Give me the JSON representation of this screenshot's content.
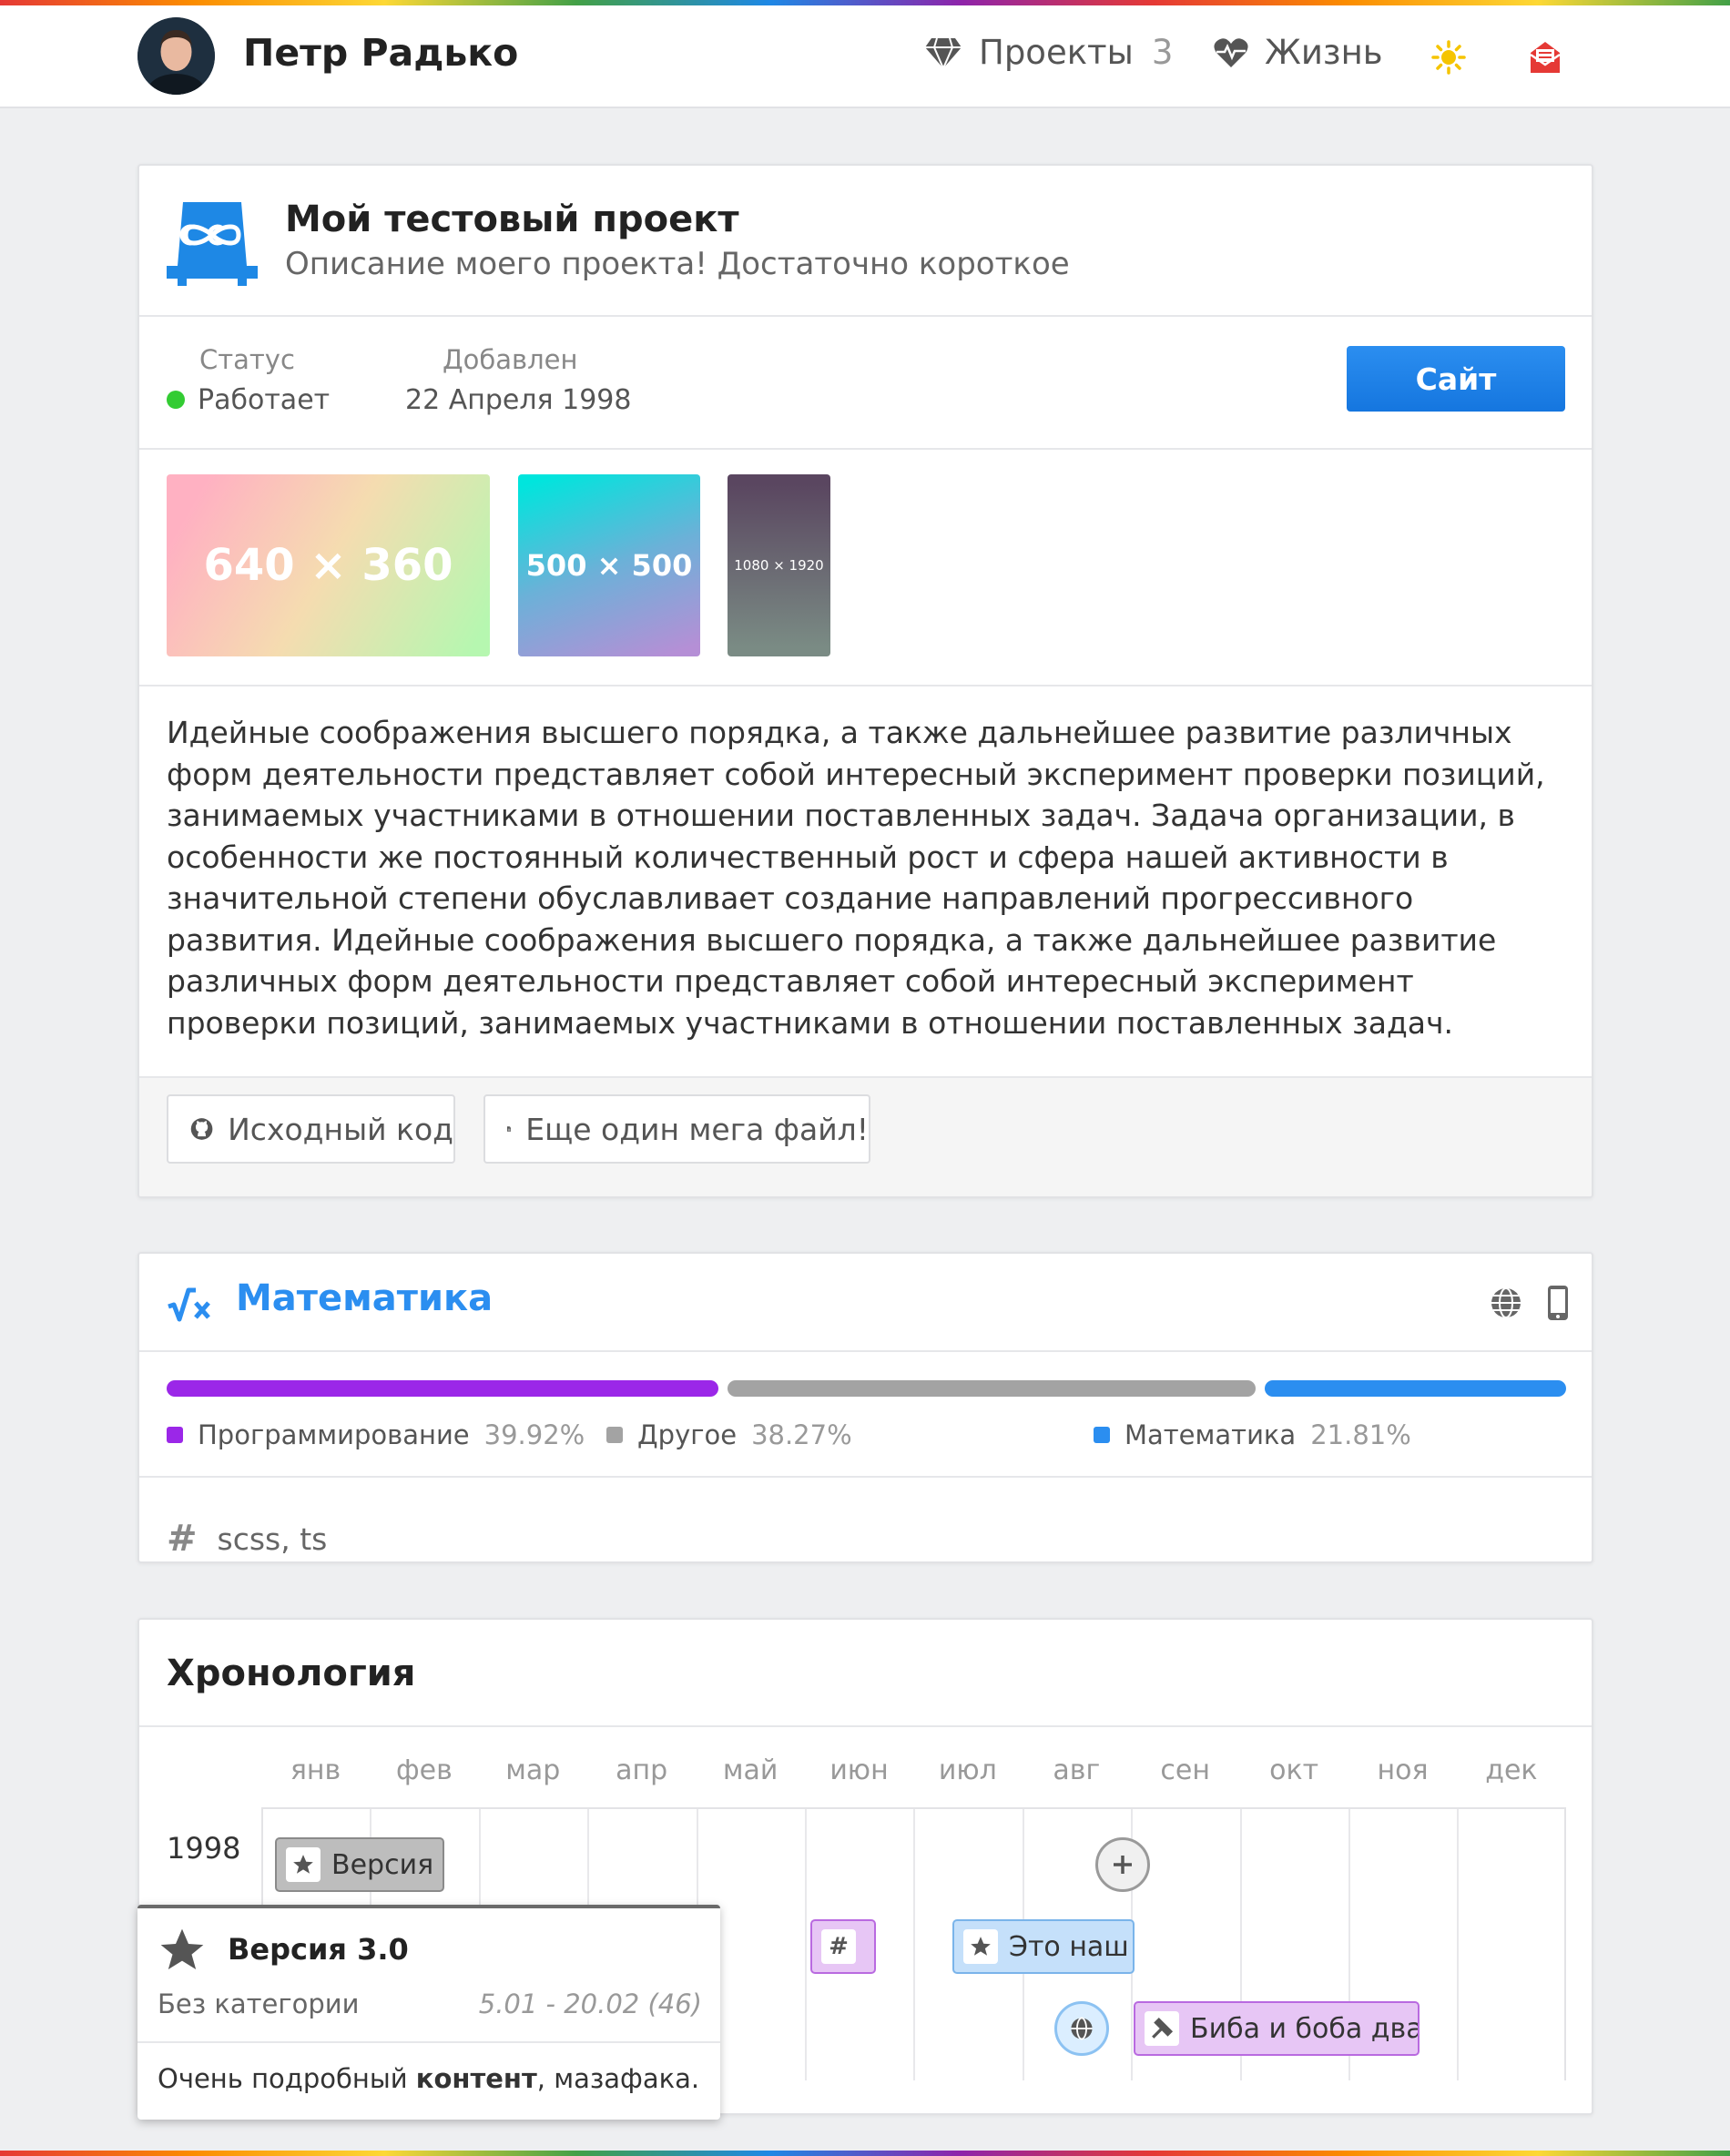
{
  "header": {
    "name": "Петр Радько",
    "nav": {
      "projects_label": "Проекты",
      "projects_count": "3",
      "life_label": "Жизнь"
    }
  },
  "project": {
    "title": "Мой тестовый проект",
    "description": "Описание моего проекта! Достаточно короткое",
    "status_label": "Статус",
    "status_value": "Работает",
    "added_label": "Добавлен",
    "added_value": "22 Апреля 1998",
    "site_button": "Сайт",
    "images": [
      "640 × 360",
      "500 × 500",
      "1080 × 1920"
    ],
    "body": "Идейные соображения высшего порядка, а также дальнейшее развитие различных форм деятельности представляет собой интересный эксперимент проверки позиций, занимаемых участниками в отношении поставленных задач. Задача организации, в особенности же постоянный количественный рост и сфера нашей активности в значительной степени обуславливает создание направлений прогрессивного развития. Идейные соображения высшего порядка, а также дальнейшее развитие различных форм деятельности представляет собой интересный эксперимент проверки позиций, занимаемых участниками в отношении поставленных задач.",
    "files": [
      "Исходный код",
      "Еще один мега файл!"
    ]
  },
  "category": {
    "title": "Математика",
    "breakdown": [
      {
        "name": "Программирование",
        "percent": "39.92%",
        "share": 39.92,
        "color": "#9b27e8"
      },
      {
        "name": "Другое",
        "percent": "38.27%",
        "share": 38.27,
        "color": "#a3a3a3"
      },
      {
        "name": "Математика",
        "percent": "21.81%",
        "share": 21.81,
        "color": "#2b8ef0"
      }
    ],
    "tags": "scss,  ts"
  },
  "chronology": {
    "title": "Хронология",
    "months": [
      "янв",
      "фев",
      "мар",
      "апр",
      "май",
      "июн",
      "июл",
      "авг",
      "сен",
      "окт",
      "ноя",
      "дек"
    ],
    "year": "1998",
    "events": {
      "version": "Версия 3.0",
      "hash_glyph": "#",
      "our": "Это наш проект",
      "biba": "Биба и боба два г"
    }
  },
  "popup": {
    "title": "Версия 3.0",
    "category": "Без категории",
    "range": "5.01 - 20.02 (46)",
    "content_before": "Очень подробный ",
    "content_bold": "контент",
    "content_after": ", мазафака."
  },
  "colors": {
    "accent": "#2b8ef0",
    "status_ok": "#33cc33",
    "programming": "#9b27e8",
    "other": "#a3a3a3"
  }
}
